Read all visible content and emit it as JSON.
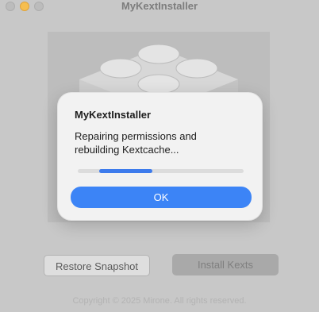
{
  "window": {
    "title": "MyKextInstaller"
  },
  "main": {
    "hero_icon": "lego-brick-icon",
    "restore_label": "Restore Snapshot",
    "install_label": "Install Kexts",
    "copyright": "Copyright © 2025 Mirone. All rights reserved."
  },
  "dialog": {
    "title": "MyKextInstaller",
    "message": "Repairing permissions and rebuilding Kextcache...",
    "progress_fraction_start": 0.13,
    "progress_fraction_end": 0.45,
    "ok_label": "OK"
  },
  "colors": {
    "accent": "#3c84f6",
    "progress": "#3d7bec",
    "minimize": "#f6be4f"
  }
}
